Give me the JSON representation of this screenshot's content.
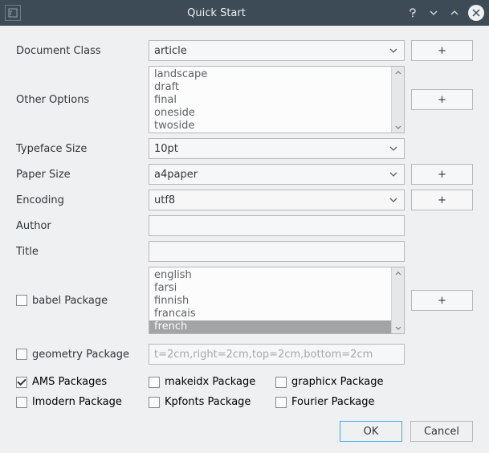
{
  "window": {
    "title": "Quick Start"
  },
  "labels": {
    "document_class": "Document Class",
    "other_options": "Other Options",
    "typeface_size": "Typeface Size",
    "paper_size": "Paper Size",
    "encoding": "Encoding",
    "author": "Author",
    "title": "Title",
    "babel": "babel Package",
    "geometry": "geometry Package",
    "ams": "AMS Packages",
    "makeidx": "makeidx Package",
    "graphicx": "graphicx Package",
    "lmodern": "lmodern Package",
    "kpfonts": "Kpfonts Package",
    "fourier": "Fourier Package"
  },
  "values": {
    "document_class": "article",
    "typeface_size": "10pt",
    "paper_size": "a4paper",
    "encoding": "utf8",
    "author": "",
    "title": "",
    "geometry_placeholder": "t=2cm,right=2cm,top=2cm,bottom=2cm"
  },
  "other_options": [
    "landscape",
    "draft",
    "final",
    "oneside",
    "twoside"
  ],
  "babel_languages": [
    "english",
    "farsi",
    "finnish",
    "francais",
    "french"
  ],
  "babel_selected": "french",
  "checks": {
    "babel": false,
    "geometry": false,
    "ams": true,
    "makeidx": false,
    "graphicx": false,
    "lmodern": false,
    "kpfonts": false,
    "fourier": false
  },
  "buttons": {
    "add": "+",
    "ok": "OK",
    "cancel": "Cancel"
  }
}
